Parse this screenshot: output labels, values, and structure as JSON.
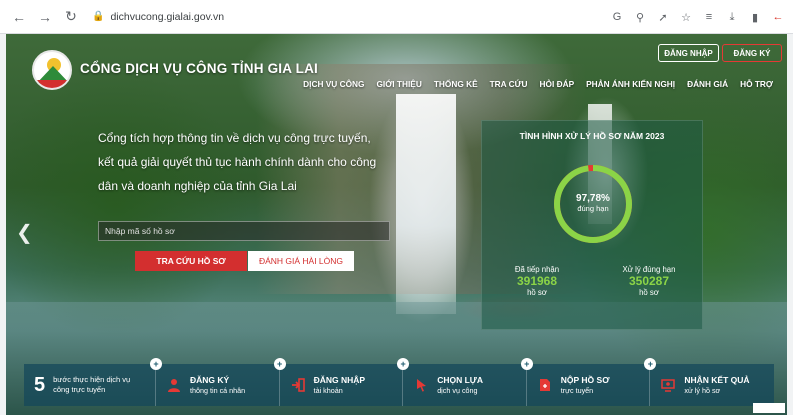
{
  "browser": {
    "url": "dichvucong.gialai.gov.vn",
    "icons": [
      "back-icon",
      "forward-icon",
      "reload-icon",
      "lock-icon",
      "translate-icon",
      "zoom-icon",
      "share-icon",
      "star-icon",
      "playlist-icon",
      "download-icon",
      "sidebar-icon",
      "extension-icon"
    ]
  },
  "header": {
    "site_title": "CỔNG DỊCH VỤ CÔNG TỈNH GIA LAI",
    "login_label": "ĐĂNG NHẬP",
    "register_label": "ĐĂNG KÝ",
    "menu": [
      "DỊCH VỤ CÔNG",
      "GIỚI THIỆU",
      "THỐNG KÊ",
      "TRA CỨU",
      "HỎI ĐÁP",
      "PHẢN ÁNH KIẾN NGHỊ",
      "ĐÁNH GIÁ",
      "HỖ TRỢ"
    ]
  },
  "intro": {
    "text": "Cổng tích hợp thông tin về dịch vụ công trực tuyến, kết quả giải quyết thủ tục hành chính dành cho công dân và doanh nghiệp của tỉnh Gia Lai",
    "search_placeholder": "Nhập mã số hồ sơ",
    "lookup_button": "TRA CỨU HỒ SƠ",
    "rate_button": "ĐÁNH GIÁ HÀI LÒNG"
  },
  "stats": {
    "title": "TÌNH HÌNH XỬ LÝ HỒ SƠ NĂM 2023",
    "on_time_percent": 97.78,
    "on_time_percent_label": "97,78%",
    "on_time_label": "đúng hạn",
    "received_label": "Đã tiếp nhận",
    "received_value": "391968",
    "received_unit": "hồ sơ",
    "processed_label": "Xử lý đúng hạn",
    "processed_value": "350287",
    "processed_unit": "hồ sơ",
    "colors": {
      "ring": "#8bd447",
      "ring_late": "#e53935",
      "value": "#8bd447"
    }
  },
  "steps": {
    "count": "5",
    "intro_text": "bước thực hiện dịch vụ công trực tuyến",
    "items": [
      {
        "title": "ĐĂNG KÝ",
        "sub": "thông tin cá nhân",
        "icon": "person-icon"
      },
      {
        "title": "ĐĂNG NHẬP",
        "sub": "tài khoản",
        "icon": "login-icon"
      },
      {
        "title": "CHỌN LỰA",
        "sub": "dịch vụ công",
        "icon": "cursor-icon"
      },
      {
        "title": "NỘP HỒ SƠ",
        "sub": "trực tuyến",
        "icon": "document-icon"
      },
      {
        "title": "NHẬN KẾT QUẢ",
        "sub": "xử lý hồ sơ",
        "icon": "monitor-user-icon"
      }
    ],
    "accent": "#e53935"
  }
}
